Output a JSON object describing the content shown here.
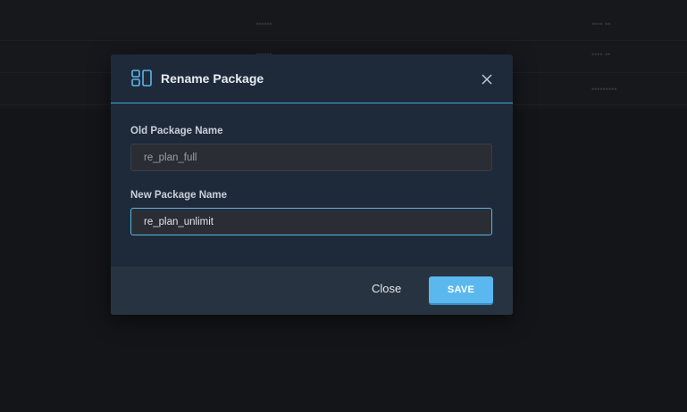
{
  "background_table": {
    "rows": [
      {
        "col_a": "••••••",
        "col_b": "•••• ••"
      },
      {
        "col_a": "••••••",
        "col_b": "•••• ••"
      },
      {
        "col_a": "",
        "col_b": "•••••••••"
      }
    ]
  },
  "modal": {
    "title": "Rename Package",
    "icon": "package-layout-icon",
    "fields": {
      "old": {
        "label": "Old Package Name",
        "value": "re_plan_full"
      },
      "new": {
        "label": "New Package Name",
        "value": "re_plan_unlimit"
      }
    },
    "footer": {
      "close_label": "Close",
      "save_label": "SAVE"
    }
  },
  "colors": {
    "modal_bg": "#1e2a3a",
    "accent": "#5ab8ee",
    "footer_bg": "#283341",
    "page_bg": "#141518"
  }
}
